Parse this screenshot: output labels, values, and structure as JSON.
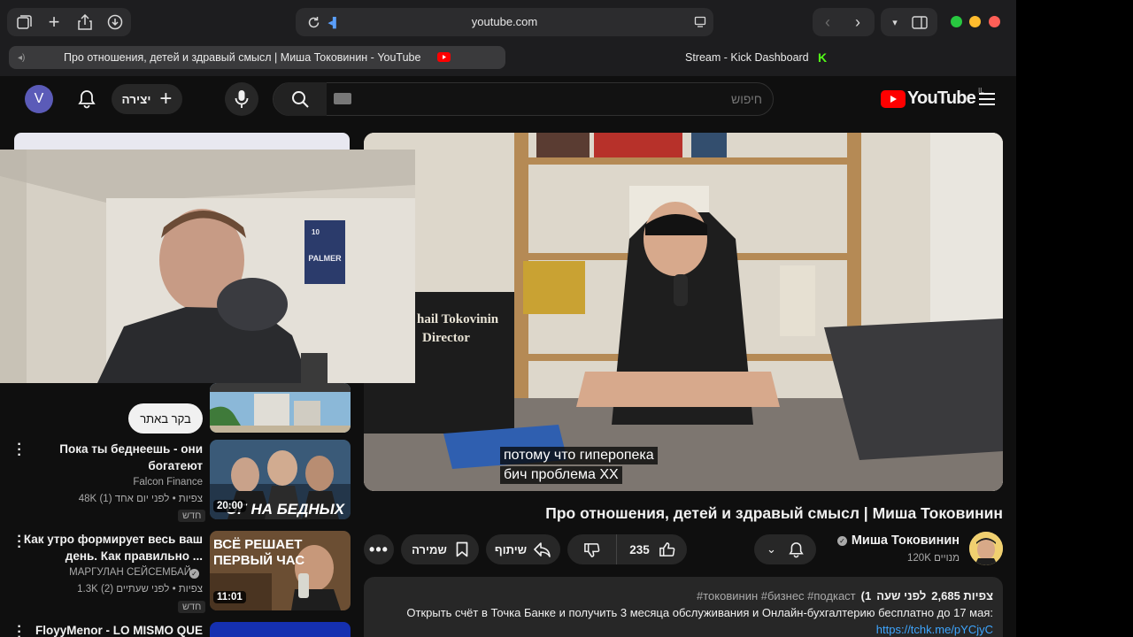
{
  "browser": {
    "url": "youtube.com",
    "tabs": [
      {
        "label": "Про отношения, детей и здравый смысл | Миша Токовинин - YouTube",
        "active": true
      },
      {
        "label": "Stream - Kick Dashboard",
        "active": false
      }
    ],
    "traffic_colors": {
      "green": "#28c840",
      "yellow": "#febc2e",
      "red": "#ff5f57"
    }
  },
  "header": {
    "avatar_letter": "V",
    "create_label": "יצירה",
    "search_placeholder": "חיפוש",
    "logo_text": "YouTube",
    "logo_region": "IL",
    "brand_color": "#ff0000"
  },
  "player": {
    "caption_line1": "потому что гиперопека",
    "caption_line2": "бич проблема ХХ",
    "director_line1": "hail Tokovinin",
    "director_line2": "Director"
  },
  "video": {
    "title": "Про отношения, детей и здравый смысл | Миша Токовинин",
    "channel_name": "Миша Токовинин",
    "subscribers": "120K מנויים",
    "likes": "235",
    "share_label": "שיתוף",
    "save_label": "שמירה",
    "views": "2,685 צפיות",
    "published": "לפני שעה",
    "hashtags": "#токовинин #бизнес #подкаст",
    "bracket_text": "(1",
    "description_line": "Открыть счёт в Точка Банке и получить 3 месяца обслуживания и Онлайн-бухгалтерию бесплатно до 17 мая:",
    "description_link": "https://tchk.me/pYCjyC"
  },
  "webcam": {
    "poster_text": "PALMER",
    "poster_number": "10"
  },
  "sidebar": {
    "visit_button": "בקר באתר",
    "recommendations": [
      {
        "title_line1": "Пока ты беднеешь - они",
        "title_line2": "богатеют",
        "channel": "Falcon Finance",
        "meta": "48K צפיות • לפני יום אחד (1)",
        "badge": "חדש",
        "duration": "20:00",
        "thumb_text": "ОГ НА БЕДНЫХ"
      },
      {
        "title_line1": "Как утро формирует весь ваш",
        "title_line2": "день.  Как правильно ...",
        "channel": "МАРГУЛАН СЕЙСЕМБАЙ",
        "meta": "1.3K צפיות • לפני שעתיים (2)",
        "badge": "חדש",
        "duration": "11:01",
        "thumb_text_1": "ВСЁ РЕШАЕТ",
        "thumb_text_2": "ПЕРВЫЙ ЧАС"
      },
      {
        "title_line1": "FloyyMenor - LO MISMO QUE",
        "title_line2": "",
        "channel": "",
        "meta": "",
        "badge": "",
        "duration": ""
      }
    ]
  }
}
